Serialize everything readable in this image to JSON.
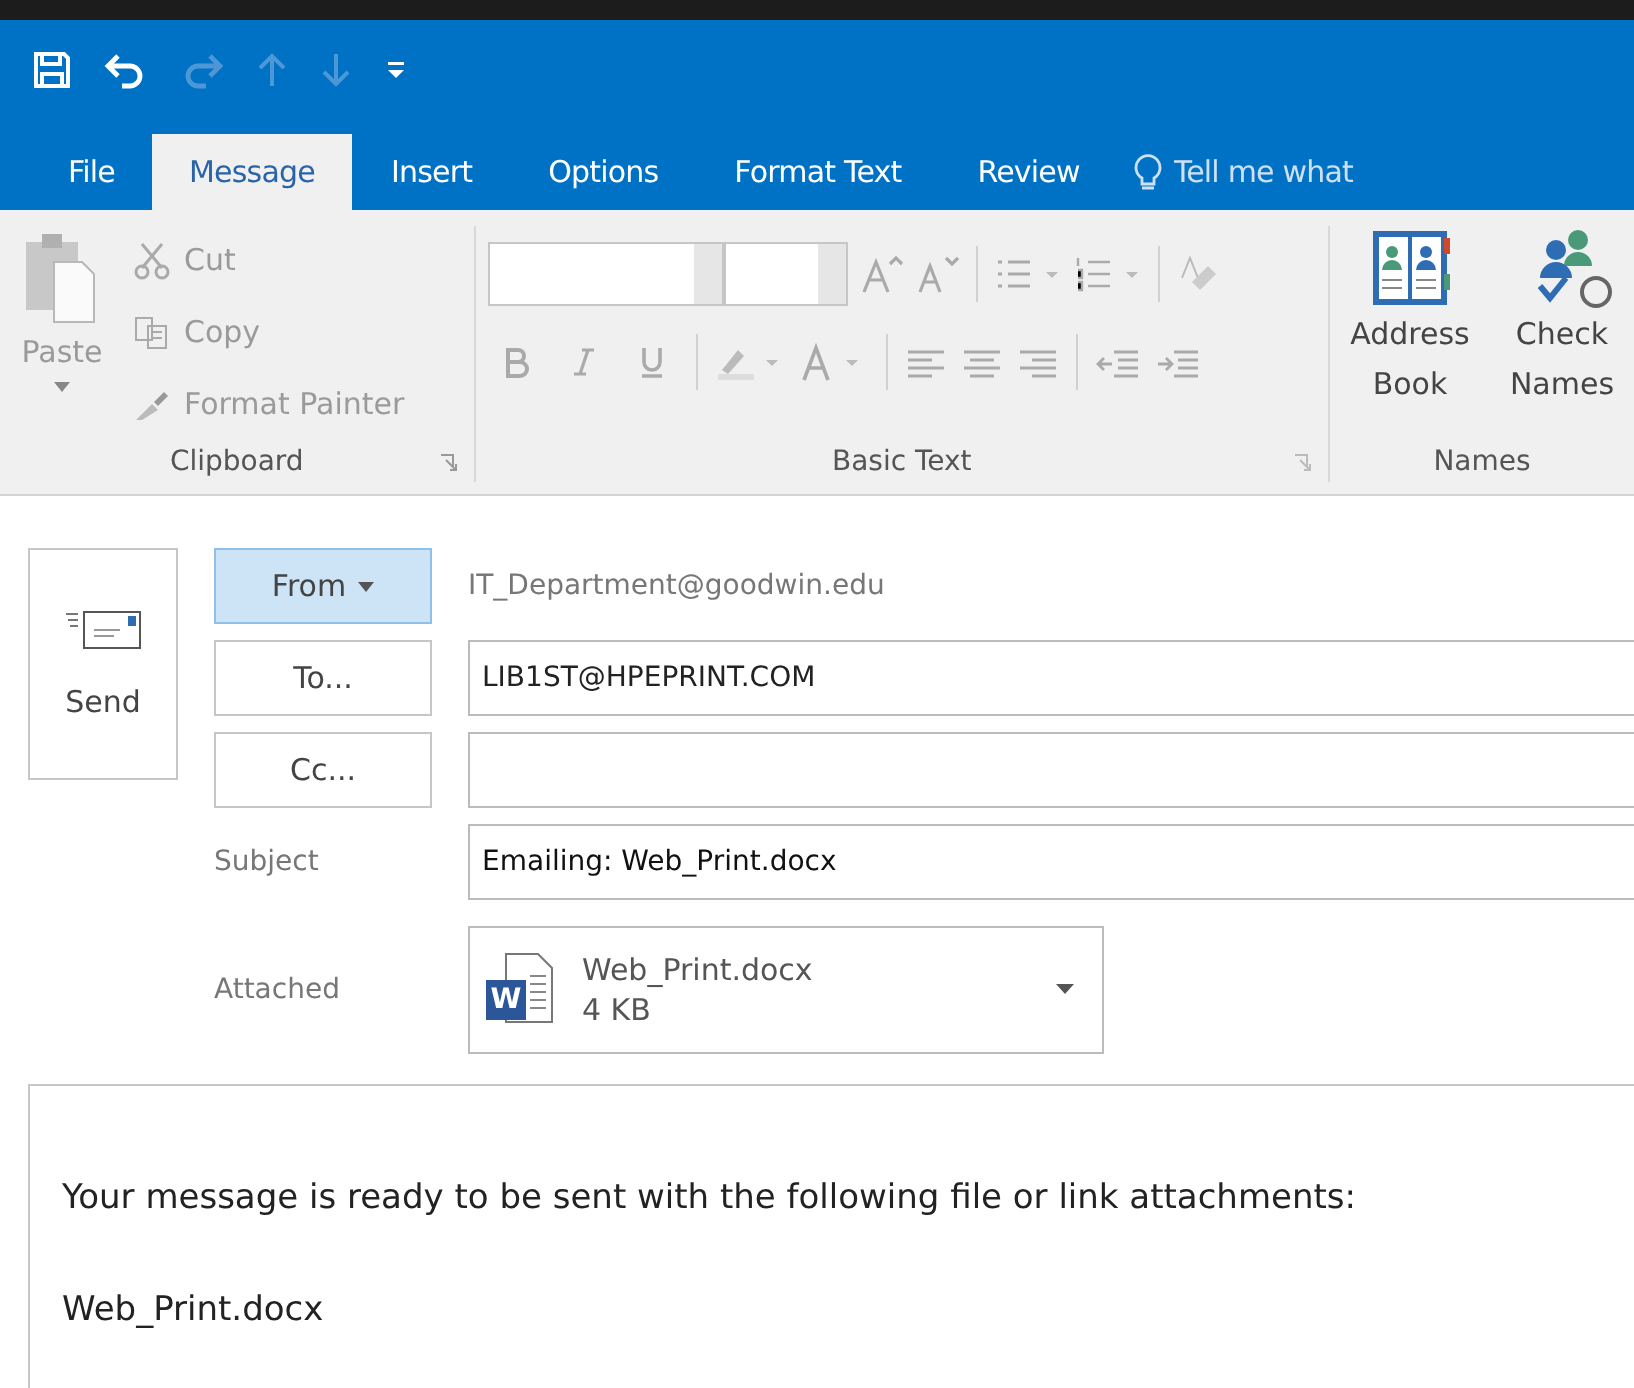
{
  "quick_access": [
    {
      "kind": "save",
      "disabled": false
    },
    {
      "kind": "undo",
      "disabled": false
    },
    {
      "kind": "redo",
      "disabled": true
    },
    {
      "kind": "up",
      "disabled": true
    },
    {
      "kind": "down",
      "disabled": true
    },
    {
      "kind": "customize",
      "disabled": false
    }
  ],
  "tabs": [
    {
      "label": "File",
      "selected": false
    },
    {
      "label": "Message",
      "selected": true
    },
    {
      "label": "Insert",
      "selected": false
    },
    {
      "label": "Options",
      "selected": false
    },
    {
      "label": "Format Text",
      "selected": false
    },
    {
      "label": "Review",
      "selected": false
    }
  ],
  "tell_me": {
    "placeholder": "Tell me what"
  },
  "ribbon": {
    "clipboard": {
      "label": "Clipboard",
      "paste": {
        "label": "Paste",
        "disabled": true
      },
      "items": [
        {
          "kind": "cut",
          "label": "Cut",
          "disabled": true
        },
        {
          "kind": "copy",
          "label": "Copy",
          "disabled": true
        },
        {
          "kind": "painter",
          "label": "Format Painter",
          "disabled": true
        }
      ]
    },
    "basic_text": {
      "label": "Basic Text"
    },
    "names": {
      "label": "Names",
      "items": [
        {
          "kind": "book",
          "label": "Address Book"
        },
        {
          "kind": "check",
          "label": "Check Names"
        }
      ]
    }
  },
  "compose": {
    "send": {
      "label": "Send"
    },
    "from": {
      "label": "From",
      "value": "IT_Department@goodwin.edu"
    },
    "to": {
      "label": "To...",
      "value": "LIB1ST@HPEPRINT.COM"
    },
    "cc": {
      "label": "Cc..."
    },
    "subject": {
      "label": "Subject",
      "value": "Emailing: Web_Print.docx"
    },
    "attached": {
      "label": "Attached",
      "file": {
        "name": "Web_Print.docx",
        "size": "4 KB",
        "icon_letter": "W"
      }
    }
  },
  "body": [
    "Your message is ready to be sent with the following file or link attachments:",
    "Web_Print.docx"
  ]
}
